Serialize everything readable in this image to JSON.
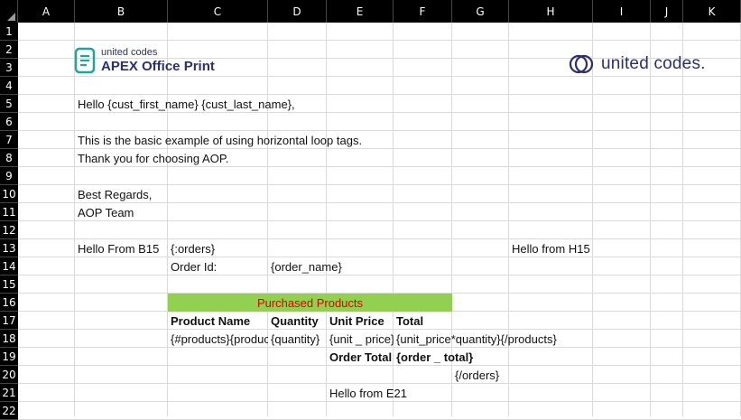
{
  "sheet": {
    "columns": [
      "A",
      "B",
      "C",
      "D",
      "E",
      "F",
      "G",
      "H",
      "I",
      "J",
      "K"
    ],
    "rows": [
      "1",
      "2",
      "3",
      "4",
      "5",
      "6",
      "7",
      "8",
      "9",
      "10",
      "11",
      "12",
      "13",
      "14",
      "15",
      "16",
      "17",
      "18",
      "19",
      "20",
      "21",
      "22"
    ]
  },
  "logos": {
    "aop_small": "united codes",
    "aop_big": "APEX Office Print",
    "uc_word": "united codes."
  },
  "cells": {
    "greeting": "Hello {cust_first_name} {cust_last_name},",
    "intro": "This is the basic example of using horizontal loop tags.",
    "thanks": "Thank you for choosing AOP.",
    "regards": "Best Regards,",
    "team": "AOP Team",
    "hello_b15": "Hello From B15",
    "orders_open": "{:orders}",
    "hello_h15": "Hello from H15",
    "order_id_label": "Order Id:",
    "order_name": "{order_name}",
    "band_title": "Purchased Products",
    "hdr_product": "Product Name",
    "hdr_quantity": "Quantity",
    "hdr_unit_price": "Unit Price",
    "hdr_total": "Total",
    "products_open": "{#products}{product_name}",
    "quantity_tag": "{quantity}",
    "unit_price_tag": "{unit _ price}",
    "line_total_tag": "{unit_price*quantity}{/products}",
    "order_total_label": "Order Total",
    "order_total_tag": "{order _ total}",
    "orders_close": "{/orders}",
    "hello_e21": "Hello from E21"
  },
  "colors": {
    "header_bg": "#000000",
    "band_fill": "#92d050",
    "band_text": "#e00000",
    "brand": "#2b2f6b"
  }
}
